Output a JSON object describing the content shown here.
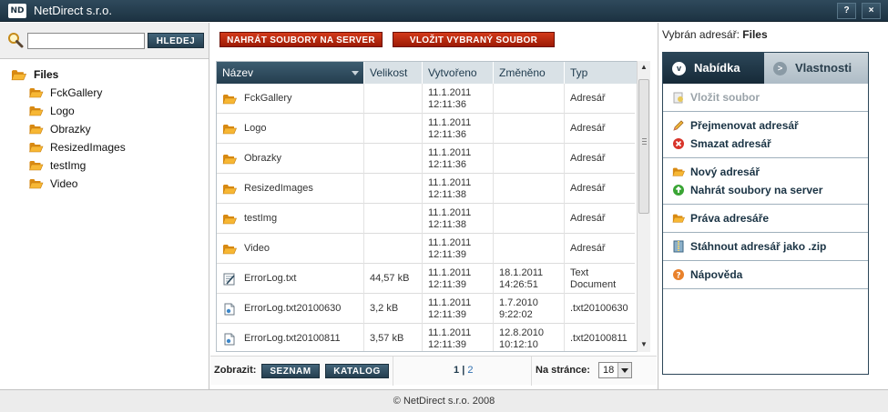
{
  "window": {
    "title": "NetDirect s.r.o.",
    "logo_text": "ND",
    "help_label": "?",
    "close_label": "×"
  },
  "search": {
    "value": "",
    "placeholder": "",
    "button_label": "HLEDEJ"
  },
  "tree": {
    "root": "Files",
    "children": [
      "FckGallery",
      "Logo",
      "Obrazky",
      "ResizedImages",
      "testImg",
      "Video"
    ]
  },
  "toolbar": {
    "upload_label": "NAHRÁT SOUBORY NA SERVER",
    "insert_label": "VLOŽIT VYBRANÝ SOUBOR"
  },
  "grid": {
    "columns": [
      "Název",
      "Velikost",
      "Vytvořeno",
      "Změněno",
      "Typ"
    ],
    "rows": [
      {
        "icon": "folder-icon",
        "name": "FckGallery",
        "size": "",
        "created": [
          "11.1.2011",
          "12:11:36"
        ],
        "modified": [
          "",
          ""
        ],
        "type": [
          "Adresář",
          ""
        ]
      },
      {
        "icon": "folder-icon",
        "name": "Logo",
        "size": "",
        "created": [
          "11.1.2011",
          "12:11:36"
        ],
        "modified": [
          "",
          ""
        ],
        "type": [
          "Adresář",
          ""
        ]
      },
      {
        "icon": "folder-icon",
        "name": "Obrazky",
        "size": "",
        "created": [
          "11.1.2011",
          "12:11:36"
        ],
        "modified": [
          "",
          ""
        ],
        "type": [
          "Adresář",
          ""
        ]
      },
      {
        "icon": "folder-icon",
        "name": "ResizedImages",
        "size": "",
        "created": [
          "11.1.2011",
          "12:11:38"
        ],
        "modified": [
          "",
          ""
        ],
        "type": [
          "Adresář",
          ""
        ]
      },
      {
        "icon": "folder-icon",
        "name": "testImg",
        "size": "",
        "created": [
          "11.1.2011",
          "12:11:38"
        ],
        "modified": [
          "",
          ""
        ],
        "type": [
          "Adresář",
          ""
        ]
      },
      {
        "icon": "folder-icon",
        "name": "Video",
        "size": "",
        "created": [
          "11.1.2011",
          "12:11:39"
        ],
        "modified": [
          "",
          ""
        ],
        "type": [
          "Adresář",
          ""
        ]
      },
      {
        "icon": "text-file-icon",
        "name": "ErrorLog.txt",
        "size": "44,57 kB",
        "created": [
          "11.1.2011",
          "12:11:39"
        ],
        "modified": [
          "18.1.2011",
          "14:26:51"
        ],
        "type": [
          "Text",
          "Document"
        ]
      },
      {
        "icon": "generic-file-icon",
        "name": "ErrorLog.txt20100630",
        "size": "3,2 kB",
        "created": [
          "11.1.2011",
          "12:11:39"
        ],
        "modified": [
          "1.7.2010",
          "9:22:02"
        ],
        "type": [
          ".txt20100630",
          ""
        ]
      },
      {
        "icon": "generic-file-icon",
        "name": "ErrorLog.txt20100811",
        "size": "3,57 kB",
        "created": [
          "11.1.2011",
          "12:11:39"
        ],
        "modified": [
          "12.8.2010",
          "10:12:10"
        ],
        "type": [
          ".txt20100811",
          ""
        ]
      }
    ]
  },
  "pager": {
    "view_label": "Zobrazit:",
    "list_button": "SEZNAM",
    "catalog_button": "KATALOG",
    "current_page": "1",
    "separator": "|",
    "next_page": "2",
    "per_page_label": "Na stránce:",
    "per_page_value": "18"
  },
  "right": {
    "selected_label": "Vybrán adresář:",
    "selected_value": "Files",
    "tab_menu": "Nabídka",
    "tab_menu_icon": "v",
    "tab_props": "Vlastnosti",
    "tab_props_icon": ">",
    "actions": {
      "insert_file": "Vložit soubor",
      "rename_dir": "Přejmenovat adresář",
      "delete_dir": "Smazat adresář",
      "new_dir": "Nový adresář",
      "upload_files": "Nahrát soubory na server",
      "dir_rights": "Práva adresáře",
      "download_zip": "Stáhnout adresář jako .zip",
      "help": "Nápověda"
    }
  },
  "footer": {
    "text": "© NetDirect s.r.o. 2008"
  }
}
